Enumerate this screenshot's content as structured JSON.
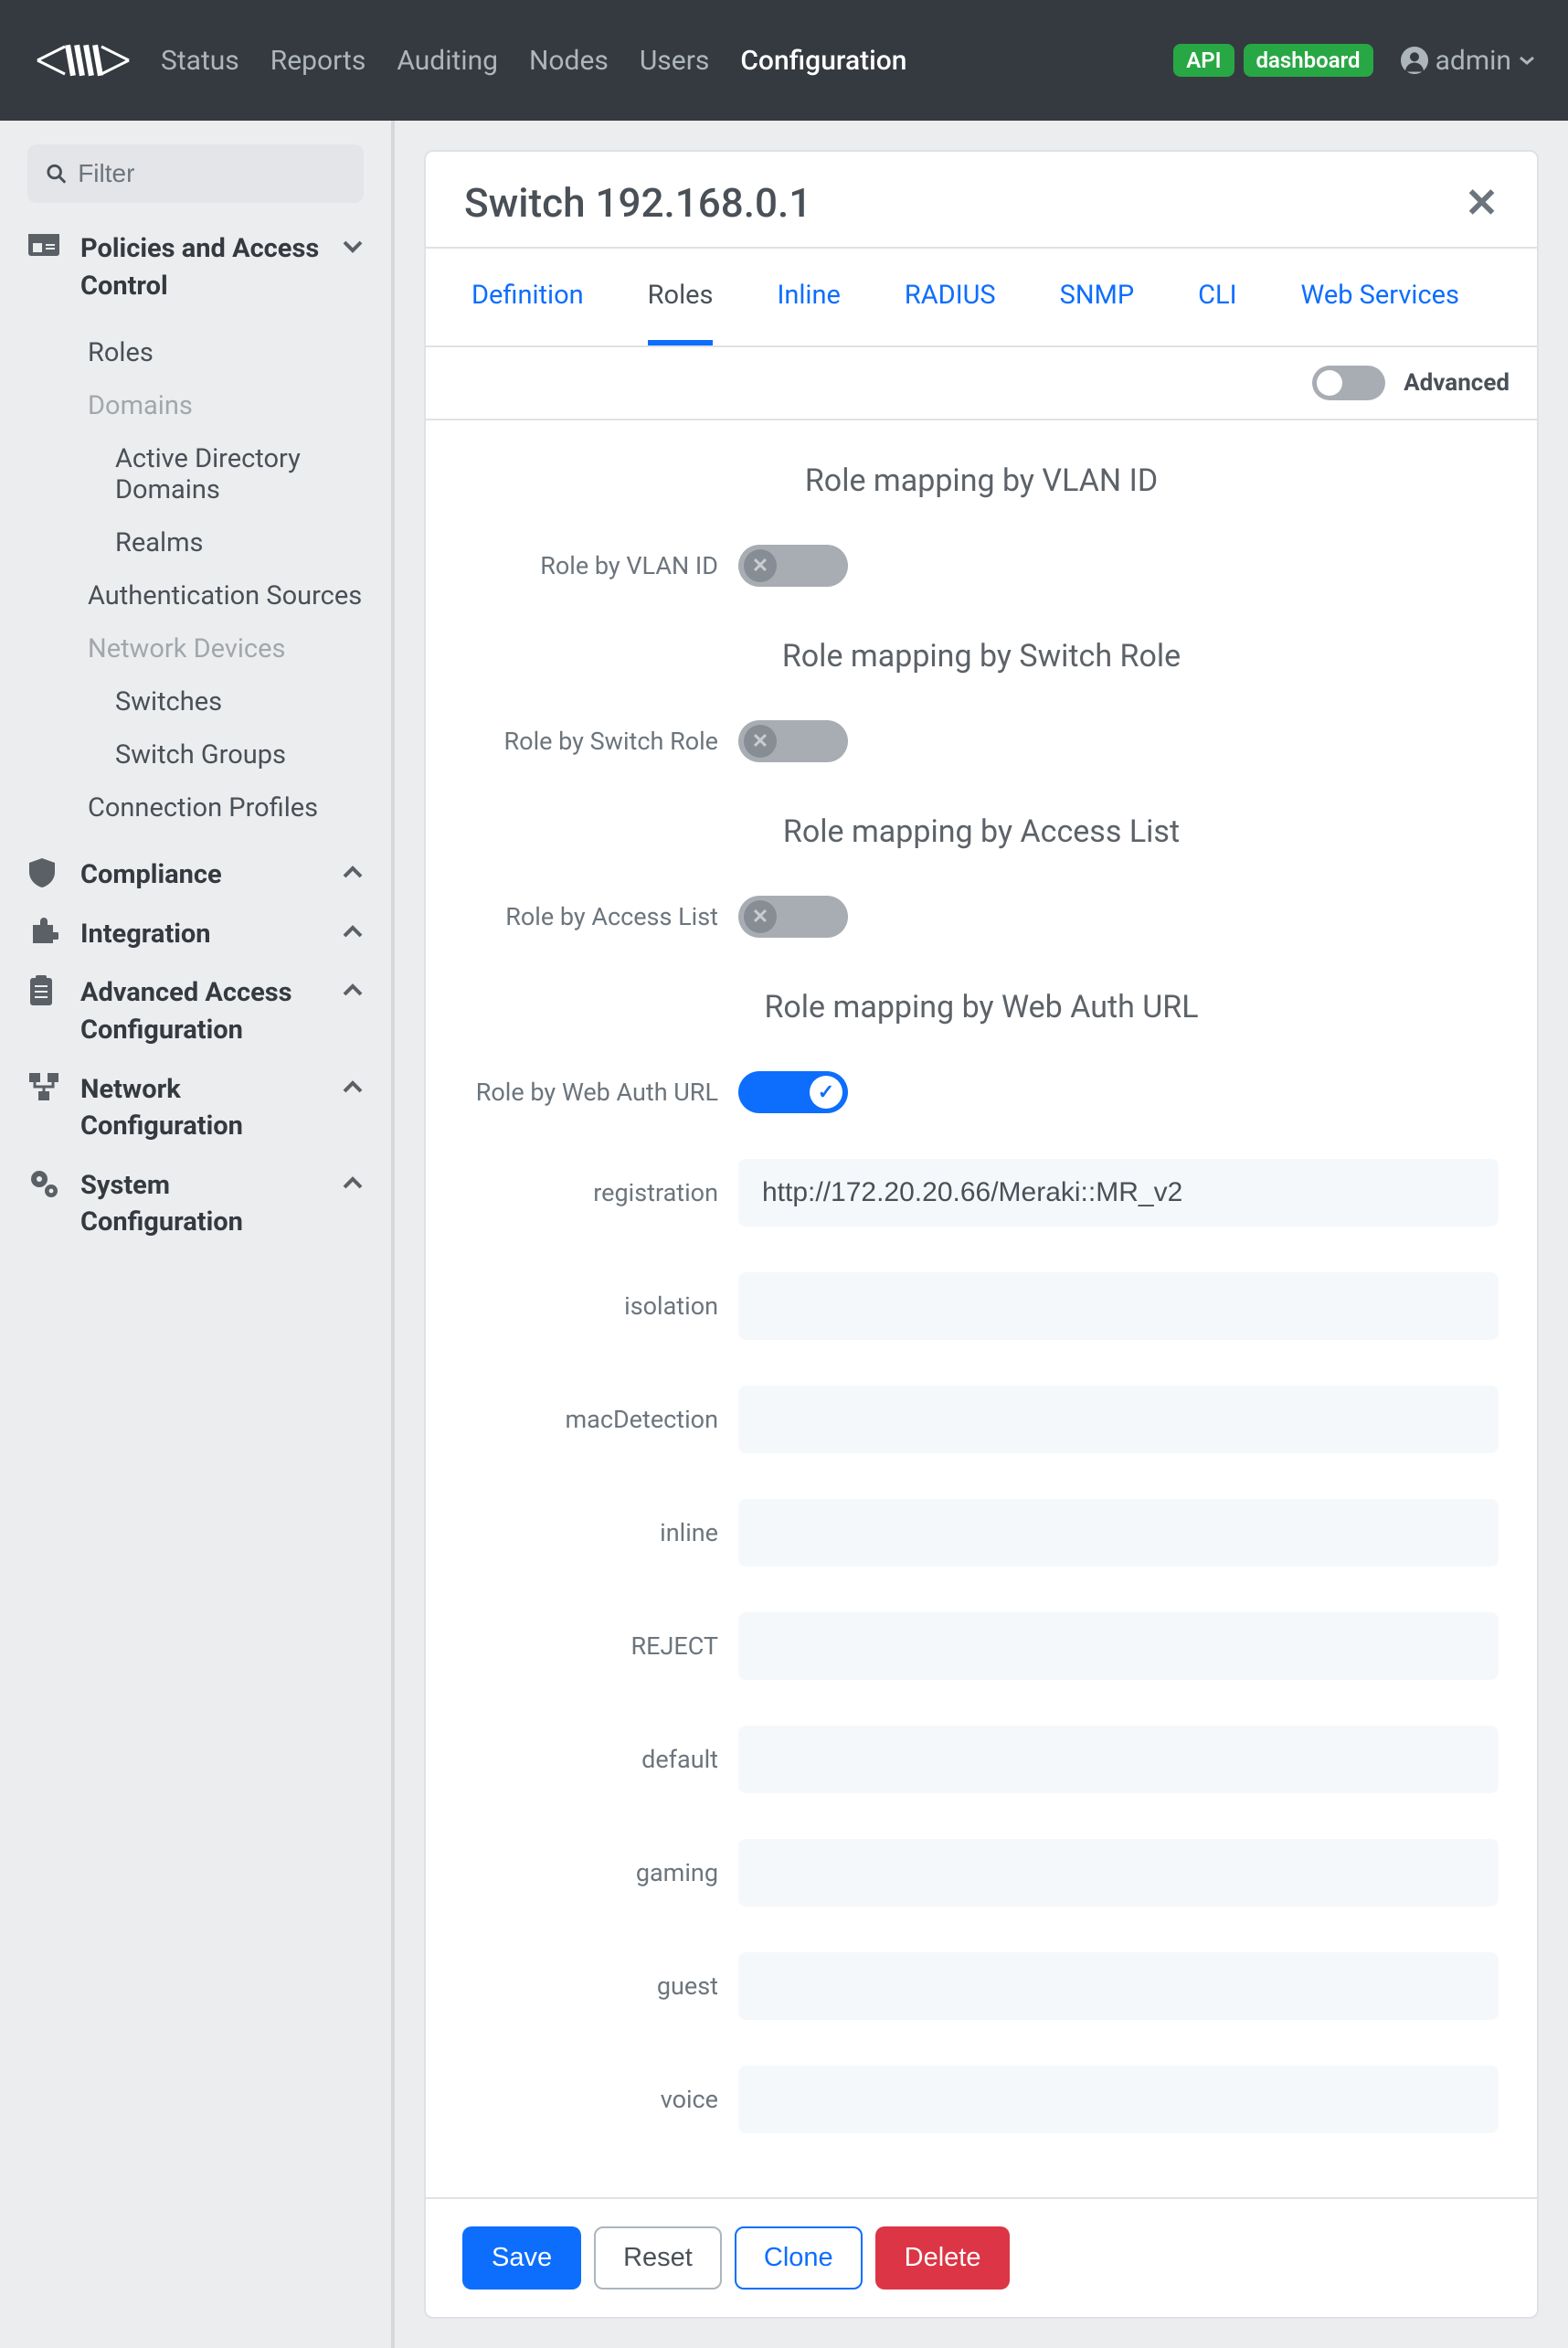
{
  "nav": {
    "items": [
      "Status",
      "Reports",
      "Auditing",
      "Nodes",
      "Users",
      "Configuration"
    ],
    "active": "Configuration",
    "badges": [
      "API",
      "dashboard"
    ],
    "user": "admin"
  },
  "sidebar": {
    "filter_placeholder": "Filter",
    "sections": {
      "policies": {
        "label": "Policies and Access Control",
        "roles": "Roles",
        "domains_header": "Domains",
        "ad_domains": "Active Directory Domains",
        "realms": "Realms",
        "auth_sources": "Authentication Sources",
        "netdev_header": "Network Devices",
        "switches": "Switches",
        "switch_groups": "Switch Groups",
        "conn_profiles": "Connection Profiles"
      },
      "compliance": "Compliance",
      "integration": "Integration",
      "advanced": "Advanced Access Configuration",
      "network": "Network Configuration",
      "system": "System Configuration"
    }
  },
  "panel": {
    "title": "Switch 192.168.0.1",
    "tabs": [
      "Definition",
      "Roles",
      "Inline",
      "RADIUS",
      "SNMP",
      "CLI",
      "Web Services"
    ],
    "active_tab": "Roles",
    "advanced_label": "Advanced",
    "sections": {
      "vlan": {
        "heading": "Role mapping by VLAN ID",
        "label": "Role by VLAN ID",
        "enabled": false
      },
      "switch_role": {
        "heading": "Role mapping by Switch Role",
        "label": "Role by Switch Role",
        "enabled": false
      },
      "access_list": {
        "heading": "Role mapping by Access List",
        "label": "Role by Access List",
        "enabled": false
      },
      "web_auth": {
        "heading": "Role mapping by Web Auth URL",
        "label": "Role by Web Auth URL",
        "enabled": true,
        "fields": [
          {
            "label": "registration",
            "value": "http://172.20.20.66/Meraki::MR_v2"
          },
          {
            "label": "isolation",
            "value": ""
          },
          {
            "label": "macDetection",
            "value": ""
          },
          {
            "label": "inline",
            "value": ""
          },
          {
            "label": "REJECT",
            "value": ""
          },
          {
            "label": "default",
            "value": ""
          },
          {
            "label": "gaming",
            "value": ""
          },
          {
            "label": "guest",
            "value": ""
          },
          {
            "label": "voice",
            "value": ""
          }
        ]
      }
    },
    "buttons": {
      "save": "Save",
      "reset": "Reset",
      "clone": "Clone",
      "delete": "Delete"
    }
  }
}
